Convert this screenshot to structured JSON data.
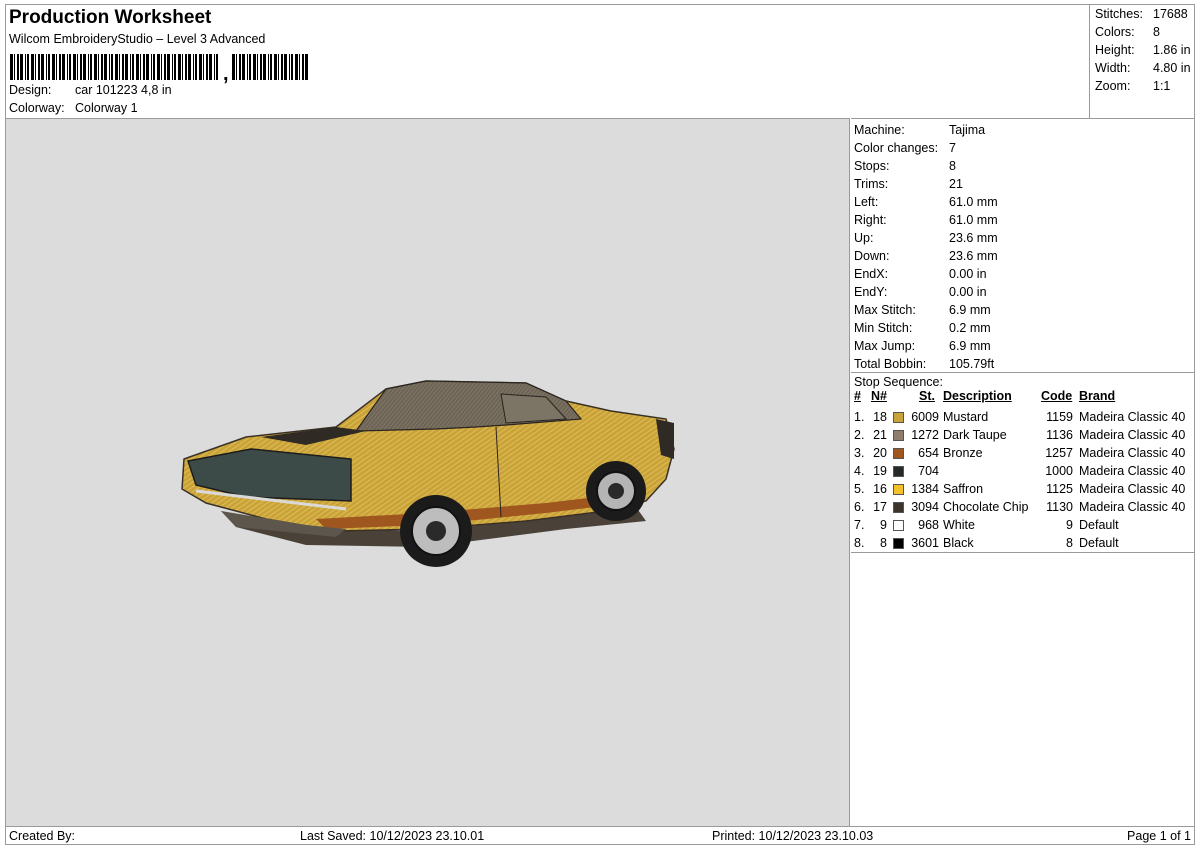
{
  "header": {
    "title": "Production Worksheet",
    "subtitle": "Wilcom EmbroideryStudio – Level 3 Advanced",
    "design_label": "Design:",
    "design_value": "car 101223 4,8 in",
    "colorway_label": "Colorway:",
    "colorway_value": "Colorway 1"
  },
  "summary": [
    {
      "label": "Stitches:",
      "value": "17688"
    },
    {
      "label": "Colors:",
      "value": "8"
    },
    {
      "label": "Height:",
      "value": "1.86 in"
    },
    {
      "label": "Width:",
      "value": "4.80 in"
    },
    {
      "label": "Zoom:",
      "value": "1:1"
    }
  ],
  "machine": [
    {
      "label": "Machine:",
      "value": "Tajima"
    },
    {
      "label": "Color changes:",
      "value": "7"
    },
    {
      "label": "Stops:",
      "value": "8"
    },
    {
      "label": "Trims:",
      "value": "21"
    },
    {
      "label": "Left:",
      "value": "61.0 mm"
    },
    {
      "label": "Right:",
      "value": "61.0 mm"
    },
    {
      "label": "Up:",
      "value": "23.6 mm"
    },
    {
      "label": "Down:",
      "value": "23.6 mm"
    },
    {
      "label": "EndX:",
      "value": "0.00 in"
    },
    {
      "label": "EndY:",
      "value": "0.00 in"
    },
    {
      "label": "Max Stitch:",
      "value": "6.9 mm"
    },
    {
      "label": "Min Stitch:",
      "value": "0.2 mm"
    },
    {
      "label": "Max Jump:",
      "value": "6.9 mm"
    },
    {
      "label": "Total Bobbin:",
      "value": "105.79ft"
    }
  ],
  "stop_sequence": {
    "title": "Stop Sequence:",
    "headers": {
      "num": "#",
      "n": "N#",
      "st": "St.",
      "description": "Description",
      "code": "Code",
      "brand": "Brand"
    },
    "rows": [
      {
        "idx": "1.",
        "n": "18",
        "color": "#c9a23a",
        "st": "6009",
        "description": "Mustard",
        "code": "1159",
        "brand": "Madeira Classic 40"
      },
      {
        "idx": "2.",
        "n": "21",
        "color": "#8f7e6e",
        "st": "1272",
        "description": "Dark Taupe",
        "code": "1136",
        "brand": "Madeira Classic 40"
      },
      {
        "idx": "3.",
        "n": "20",
        "color": "#a0561f",
        "st": "654",
        "description": "Bronze",
        "code": "1257",
        "brand": "Madeira Classic 40"
      },
      {
        "idx": "4.",
        "n": "19",
        "color": "#26292a",
        "st": "704",
        "description": "",
        "code": "1000",
        "brand": "Madeira Classic 40"
      },
      {
        "idx": "5.",
        "n": "16",
        "color": "#f4c12a",
        "st": "1384",
        "description": "Saffron",
        "code": "1125",
        "brand": "Madeira Classic 40"
      },
      {
        "idx": "6.",
        "n": "17",
        "color": "#3b342d",
        "st": "3094",
        "description": "Chocolate Chip",
        "code": "1130",
        "brand": "Madeira Classic 40"
      },
      {
        "idx": "7.",
        "n": "9",
        "color": "#ffffff",
        "st": "968",
        "description": "White",
        "code": "9",
        "brand": "Default"
      },
      {
        "idx": "8.",
        "n": "8",
        "color": "#000000",
        "st": "3601",
        "description": "Black",
        "code": "8",
        "brand": "Default"
      }
    ]
  },
  "footer": {
    "created_by": "Created By:",
    "last_saved": "Last Saved: 10/12/2023 23.10.01",
    "printed": "Printed: 10/12/2023 23.10.03",
    "page": "Page 1 of 1"
  },
  "preview": {
    "background": "#dcdcdc",
    "image": "car-embroidery-design"
  }
}
